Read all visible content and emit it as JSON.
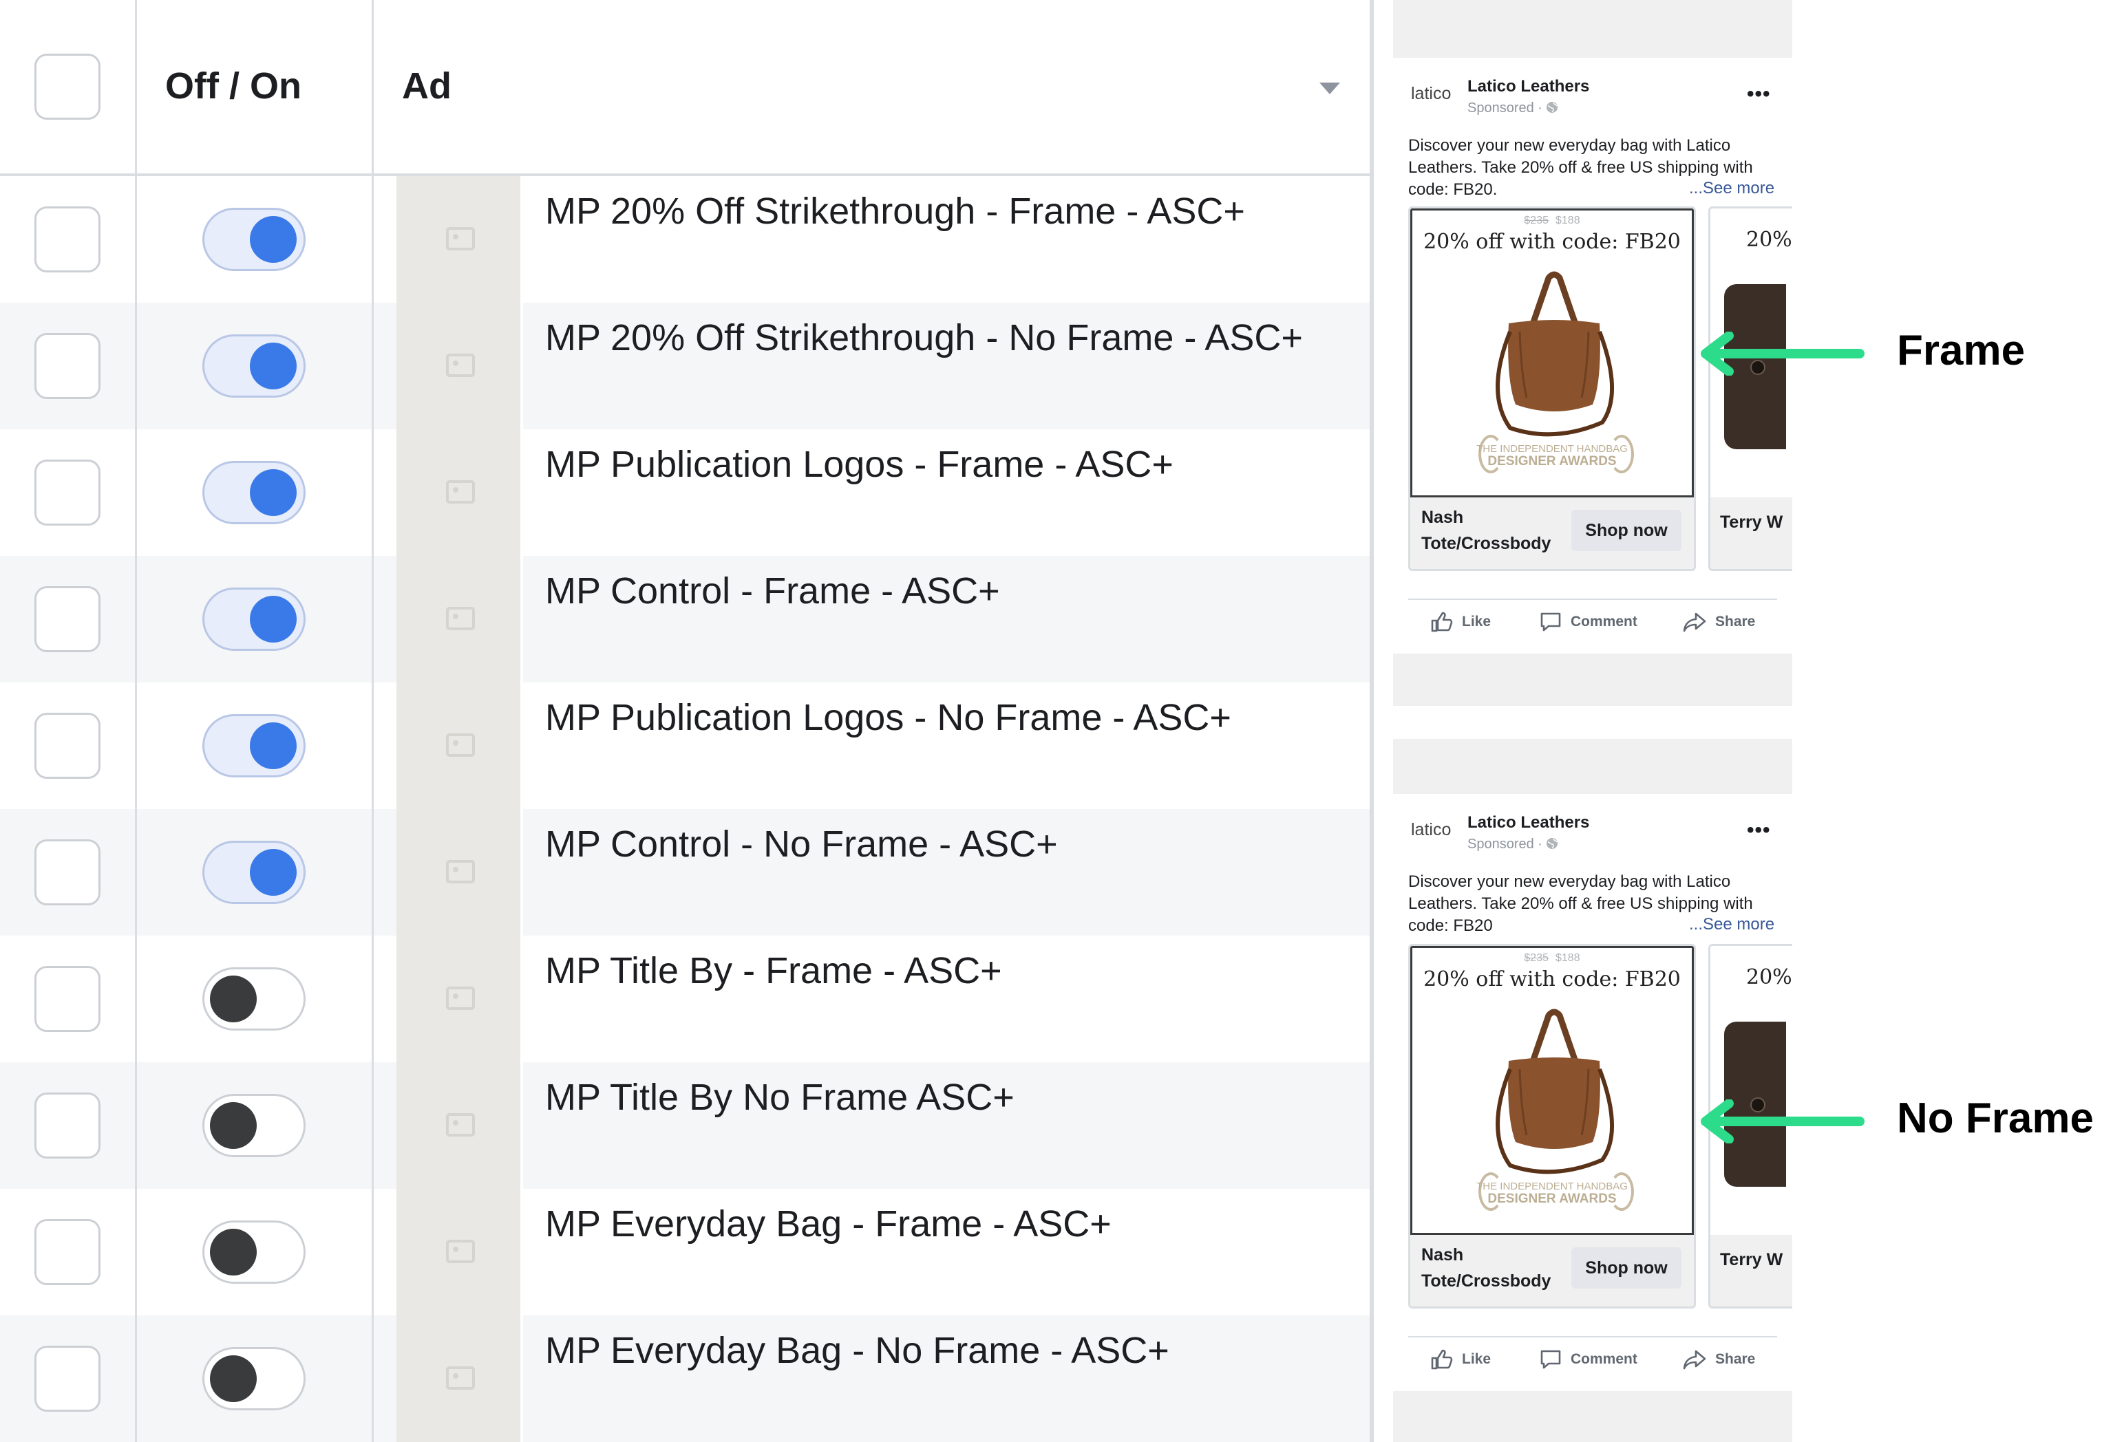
{
  "table": {
    "columns": {
      "off_on": "Off / On",
      "ad": "Ad"
    },
    "rows": [
      {
        "name": "MP 20% Off Strikethrough - Frame - ASC+",
        "toggle": "on"
      },
      {
        "name": "MP 20% Off Strikethrough - No Frame - ASC+",
        "toggle": "on"
      },
      {
        "name": "MP Publication Logos - Frame - ASC+",
        "toggle": "on"
      },
      {
        "name": "MP Control - Frame - ASC+",
        "toggle": "on"
      },
      {
        "name": "MP Publication Logos - No Frame - ASC+",
        "toggle": "on"
      },
      {
        "name": "MP Control - No Frame - ASC+",
        "toggle": "on"
      },
      {
        "name": "MP Title By - Frame - ASC+",
        "toggle": "off"
      },
      {
        "name": "MP Title By No Frame ASC+",
        "toggle": "off"
      },
      {
        "name": "MP Everyday Bag - Frame - ASC+",
        "toggle": "off"
      },
      {
        "name": "MP Everyday Bag - No Frame - ASC+",
        "toggle": "off"
      }
    ]
  },
  "previews": [
    {
      "logo": "latico",
      "page_name": "Latico Leathers",
      "sponsored": "Sponsored ·",
      "more": "•••",
      "body": "Discover your new everyday bag with Latico Leathers. Take 20% off & free US shipping with code: FB20.",
      "see_more": "...See more",
      "carousel": {
        "price_old": "$235",
        "price_new": "$188",
        "headline": "20% off with code: FB20",
        "award_line1": "THE INDEPENDENT HANDBAG",
        "award_line2": "DESIGNER AWARDS",
        "item_name": "Nash Tote/Crossbody",
        "cta": "Shop now",
        "next_headline": "20%",
        "next_item_name": "Terry W"
      },
      "actions": {
        "like": "Like",
        "comment": "Comment",
        "share": "Share"
      }
    },
    {
      "logo": "latico",
      "page_name": "Latico Leathers",
      "sponsored": "Sponsored ·",
      "more": "•••",
      "body": "Discover your new everyday bag with Latico Leathers. Take 20% off & free US shipping with code: FB20",
      "see_more": "...See more",
      "carousel": {
        "price_old": "$235",
        "price_new": "$188",
        "headline": "20% off with code: FB20",
        "award_line1": "THE INDEPENDENT HANDBAG",
        "award_line2": "DESIGNER AWARDS",
        "item_name": "Nash Tote/Crossbody",
        "cta": "Shop now",
        "next_headline": "20%",
        "next_item_name": "Terry W"
      },
      "actions": {
        "like": "Like",
        "comment": "Comment",
        "share": "Share"
      }
    }
  ],
  "annotations": {
    "frame_label": "Frame",
    "no_frame_label": "No Frame",
    "arrow_color": "#2ddc8a"
  },
  "colors": {
    "toggle_on": "#3a7ae8",
    "toggle_off_knob": "#3a3b3c",
    "row_alt": "#f5f6f7"
  },
  "icons": {
    "like": "thumbs-up-icon",
    "comment": "comment-icon",
    "share": "share-icon",
    "globe": "globe-icon",
    "sort": "caret-down-icon",
    "thumb": "image-placeholder-icon"
  }
}
